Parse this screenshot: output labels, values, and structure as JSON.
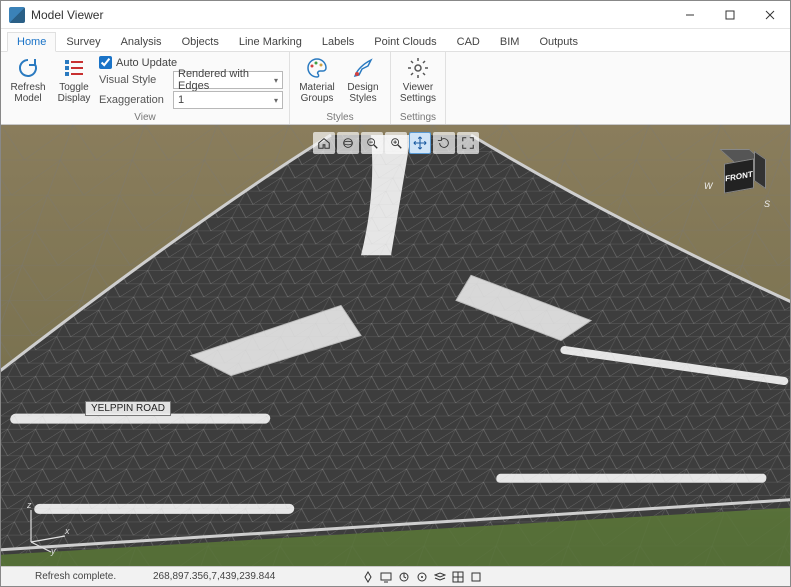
{
  "window": {
    "title": "Model Viewer"
  },
  "tabs": [
    "Home",
    "Survey",
    "Analysis",
    "Objects",
    "Line Marking",
    "Labels",
    "Point Clouds",
    "CAD",
    "BIM",
    "Outputs"
  ],
  "active_tab": 0,
  "ribbon": {
    "refresh": {
      "line1": "Refresh",
      "line2": "Model"
    },
    "toggle": {
      "line1": "Toggle",
      "line2": "Display"
    },
    "auto_update": {
      "label": "Auto Update",
      "checked": true
    },
    "visual_style": {
      "label": "Visual Style",
      "value": "Rendered with Edges"
    },
    "exaggeration": {
      "label": "Exaggeration",
      "value": "1"
    },
    "group_view": "View",
    "material": {
      "line1": "Material",
      "line2": "Groups"
    },
    "design": {
      "line1": "Design",
      "line2": "Styles"
    },
    "group_styles": "Styles",
    "viewer": {
      "line1": "Viewer",
      "line2": "Settings"
    },
    "group_settings": "Settings"
  },
  "viewport": {
    "road_label": "YELPPIN ROAD",
    "cube_face": "FRONT",
    "compass": {
      "w": "W",
      "s": "S"
    },
    "axis": {
      "x": "x",
      "y": "y",
      "z": "z"
    }
  },
  "status": {
    "message": "Refresh complete.",
    "coords": "268,897.356,7,439,239.844"
  }
}
